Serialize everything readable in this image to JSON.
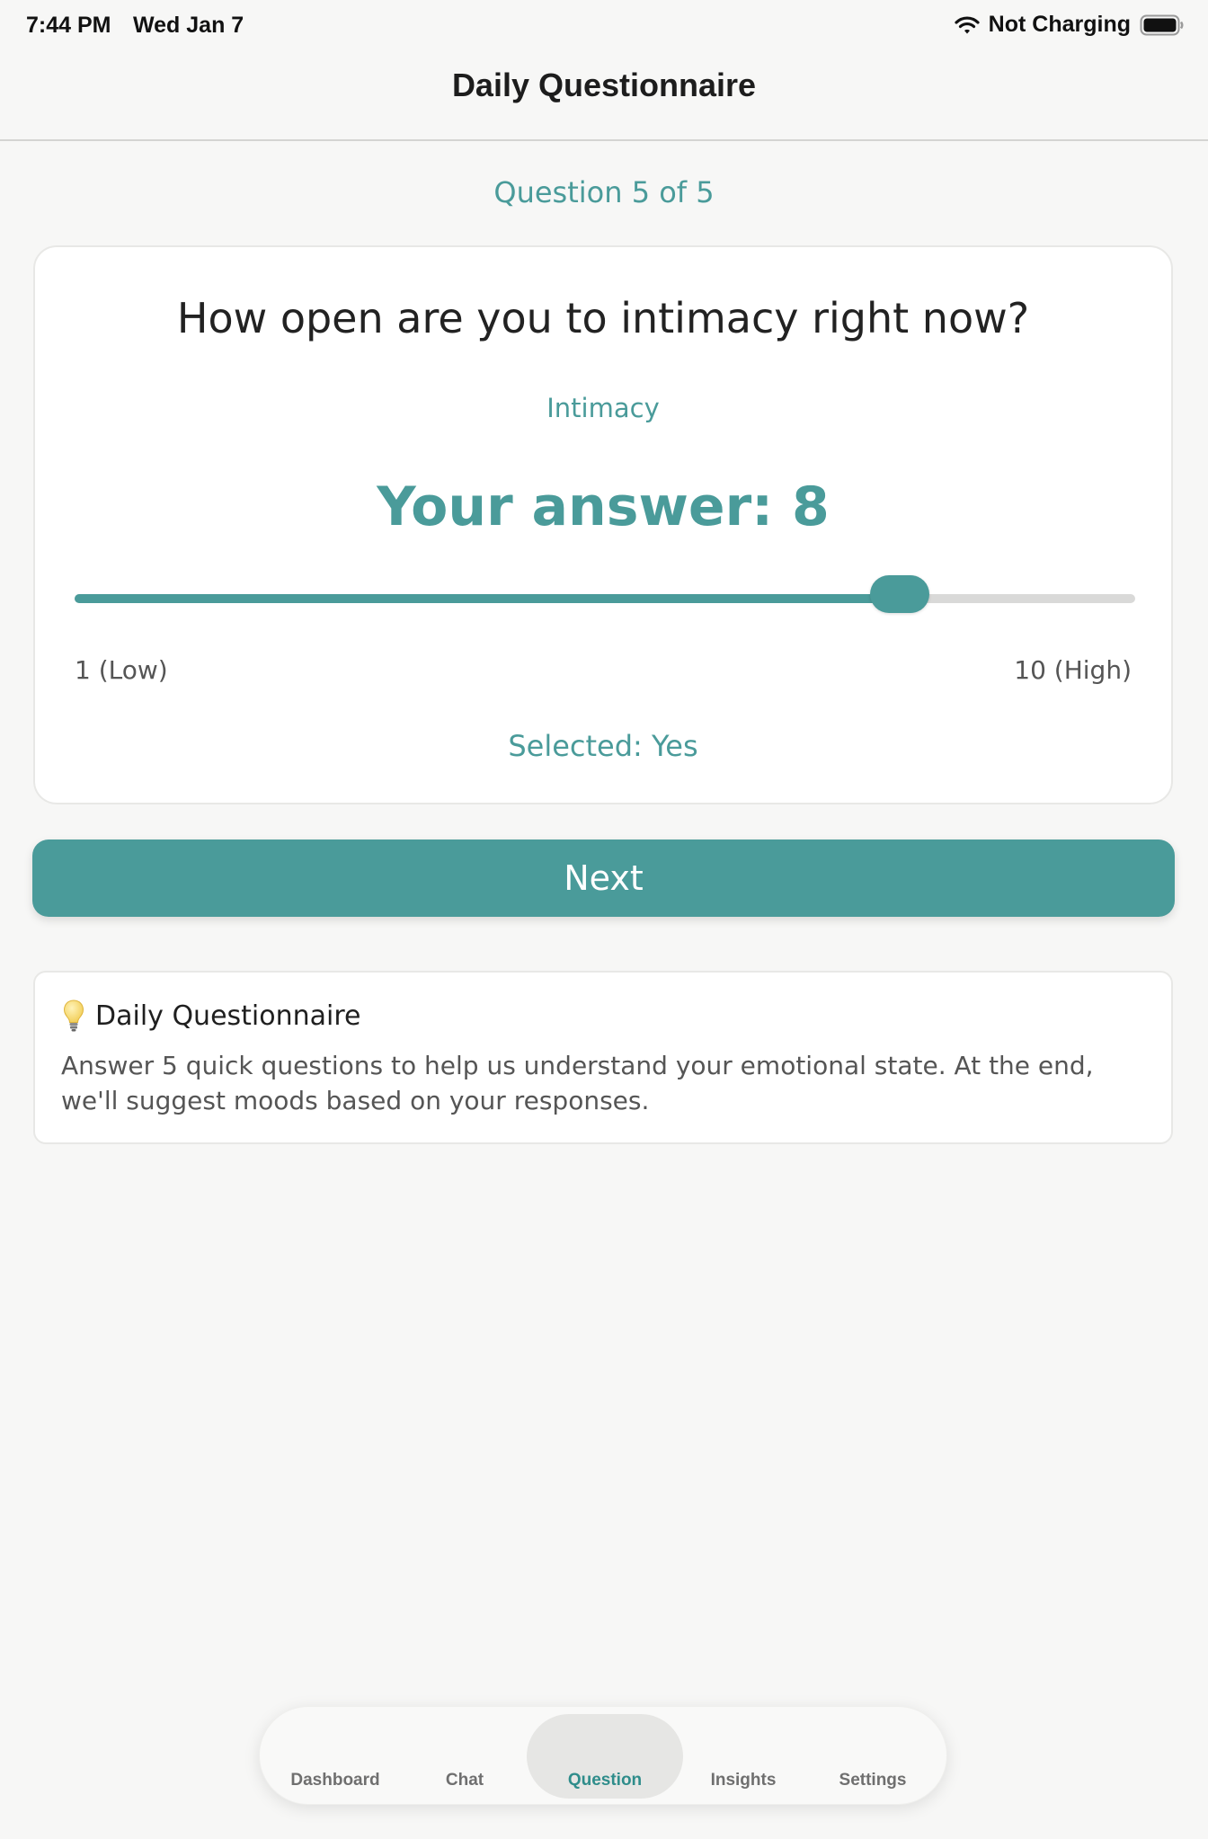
{
  "status_bar": {
    "time": "7:44 PM",
    "date": "Wed Jan 7",
    "charging": "Not Charging",
    "wifi_icon": "wifi-icon",
    "battery_icon": "battery-icon"
  },
  "header": {
    "title": "Daily Questionnaire"
  },
  "progress": {
    "label": "Question 5 of 5",
    "current": 5,
    "total": 5
  },
  "question": {
    "text": "How open are you to intimacy right now?",
    "category": "Intimacy",
    "answer_label": "Your answer: 8",
    "slider": {
      "value": 8,
      "min": 1,
      "max": 10,
      "min_label": "1 (Low)",
      "max_label": "10 (High)"
    },
    "selected_label": "Selected: Yes"
  },
  "next_button": {
    "label": "Next"
  },
  "info": {
    "icon": "lightbulb-icon",
    "title": "Daily Questionnaire",
    "body": "Answer 5 quick questions to help us understand your emotional state. At the end, we'll suggest moods based on your responses."
  },
  "tab_bar": {
    "items": [
      {
        "label": "Dashboard",
        "active": false
      },
      {
        "label": "Chat",
        "active": false
      },
      {
        "label": "Question",
        "active": true
      },
      {
        "label": "Insights",
        "active": false
      },
      {
        "label": "Settings",
        "active": false
      }
    ]
  },
  "colors": {
    "accent": "#4a9b9a",
    "background": "#f7f7f6",
    "card": "#ffffff"
  }
}
